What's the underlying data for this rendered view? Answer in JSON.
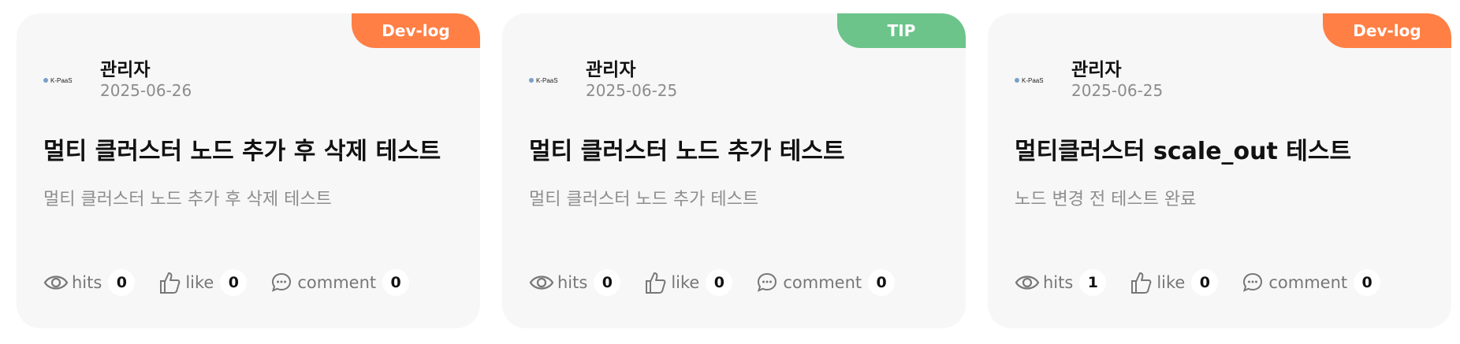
{
  "colors": {
    "devlog": "#ff7f45",
    "tip": "#6cc48b"
  },
  "icons": {
    "hits": "eye-icon",
    "like": "thumbs-up-icon",
    "comment": "comment-bubble-icon"
  },
  "cards": [
    {
      "tag": "Dev-log",
      "avatar_text": "K-PaaS",
      "author": "관리자",
      "date": "2025-06-26",
      "title": "멀티 클러스터 노드 추가 후 삭제 테스트",
      "summary": "멀티 클러스터 노드 추가 후 삭제 테스트",
      "stats": {
        "hits_label": "hits",
        "hits": "0",
        "like_label": "like",
        "like": "0",
        "comment_label": "comment",
        "comment": "0"
      }
    },
    {
      "tag": "TIP",
      "avatar_text": "K-PaaS",
      "author": "관리자",
      "date": "2025-06-25",
      "title": "멀티 클러스터 노드 추가 테스트",
      "summary": "멀티 클러스터 노드 추가 테스트",
      "stats": {
        "hits_label": "hits",
        "hits": "0",
        "like_label": "like",
        "like": "0",
        "comment_label": "comment",
        "comment": "0"
      }
    },
    {
      "tag": "Dev-log",
      "avatar_text": "K-PaaS",
      "author": "관리자",
      "date": "2025-06-25",
      "title": "멀티클러스터 scale_out 테스트",
      "summary": "노드 변경 전 테스트 완료",
      "stats": {
        "hits_label": "hits",
        "hits": "1",
        "like_label": "like",
        "like": "0",
        "comment_label": "comment",
        "comment": "0"
      }
    }
  ]
}
